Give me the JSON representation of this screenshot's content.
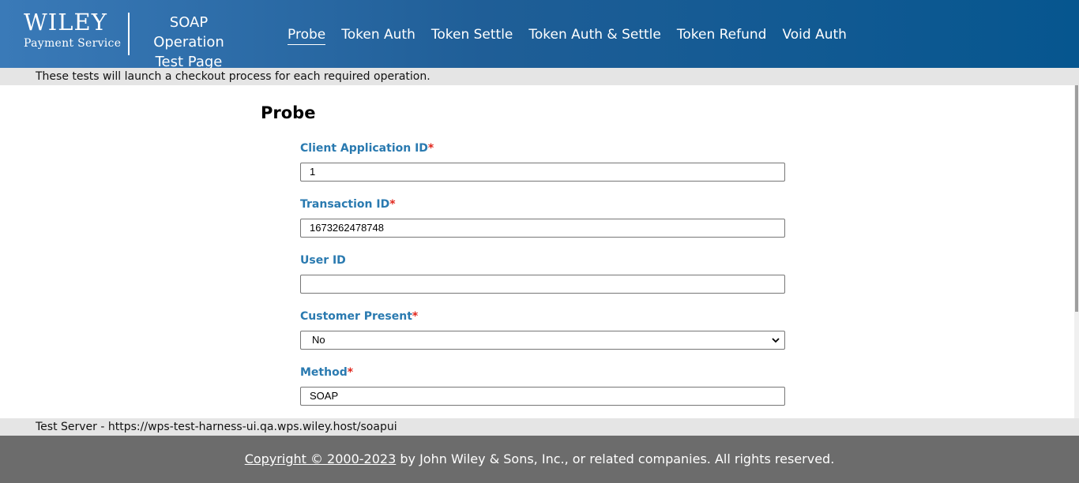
{
  "header": {
    "logo_main": "WILEY",
    "logo_sub": "Payment Service",
    "title_line1": "SOAP Operation",
    "title_line2": "Test Page"
  },
  "nav": {
    "items": [
      "Probe",
      "Token Auth",
      "Token Settle",
      "Token Auth & Settle",
      "Token Refund",
      "Void Auth"
    ],
    "active": "Probe"
  },
  "info_text": "These tests will launch a checkout process for each required operation.",
  "form": {
    "title": "Probe",
    "required_marker": "*",
    "fields": [
      {
        "label": "Client Application ID",
        "required": true,
        "value": "1"
      },
      {
        "label": "Transaction ID",
        "required": true,
        "value": "1673262478748"
      },
      {
        "label": "User ID",
        "required": false,
        "value": ""
      },
      {
        "label": "Customer Present",
        "required": true,
        "value": "No",
        "type": "select"
      },
      {
        "label": "Method",
        "required": true,
        "value": "SOAP"
      }
    ]
  },
  "server_text": "Test Server - https://wps-test-harness-ui.qa.wps.wiley.host/soapui",
  "footer": {
    "copyright_link": "Copyright © 2000-2023",
    "copyright_rest": " by John Wiley & Sons, Inc., or related companies. All rights reserved."
  },
  "colors": {
    "header_start": "#3a7ab8",
    "header_end": "#06568f",
    "label": "#2a7ab0",
    "required": "#e0261c",
    "footer_bg": "#6c6c6c",
    "bar_bg": "#e5e5e5"
  }
}
